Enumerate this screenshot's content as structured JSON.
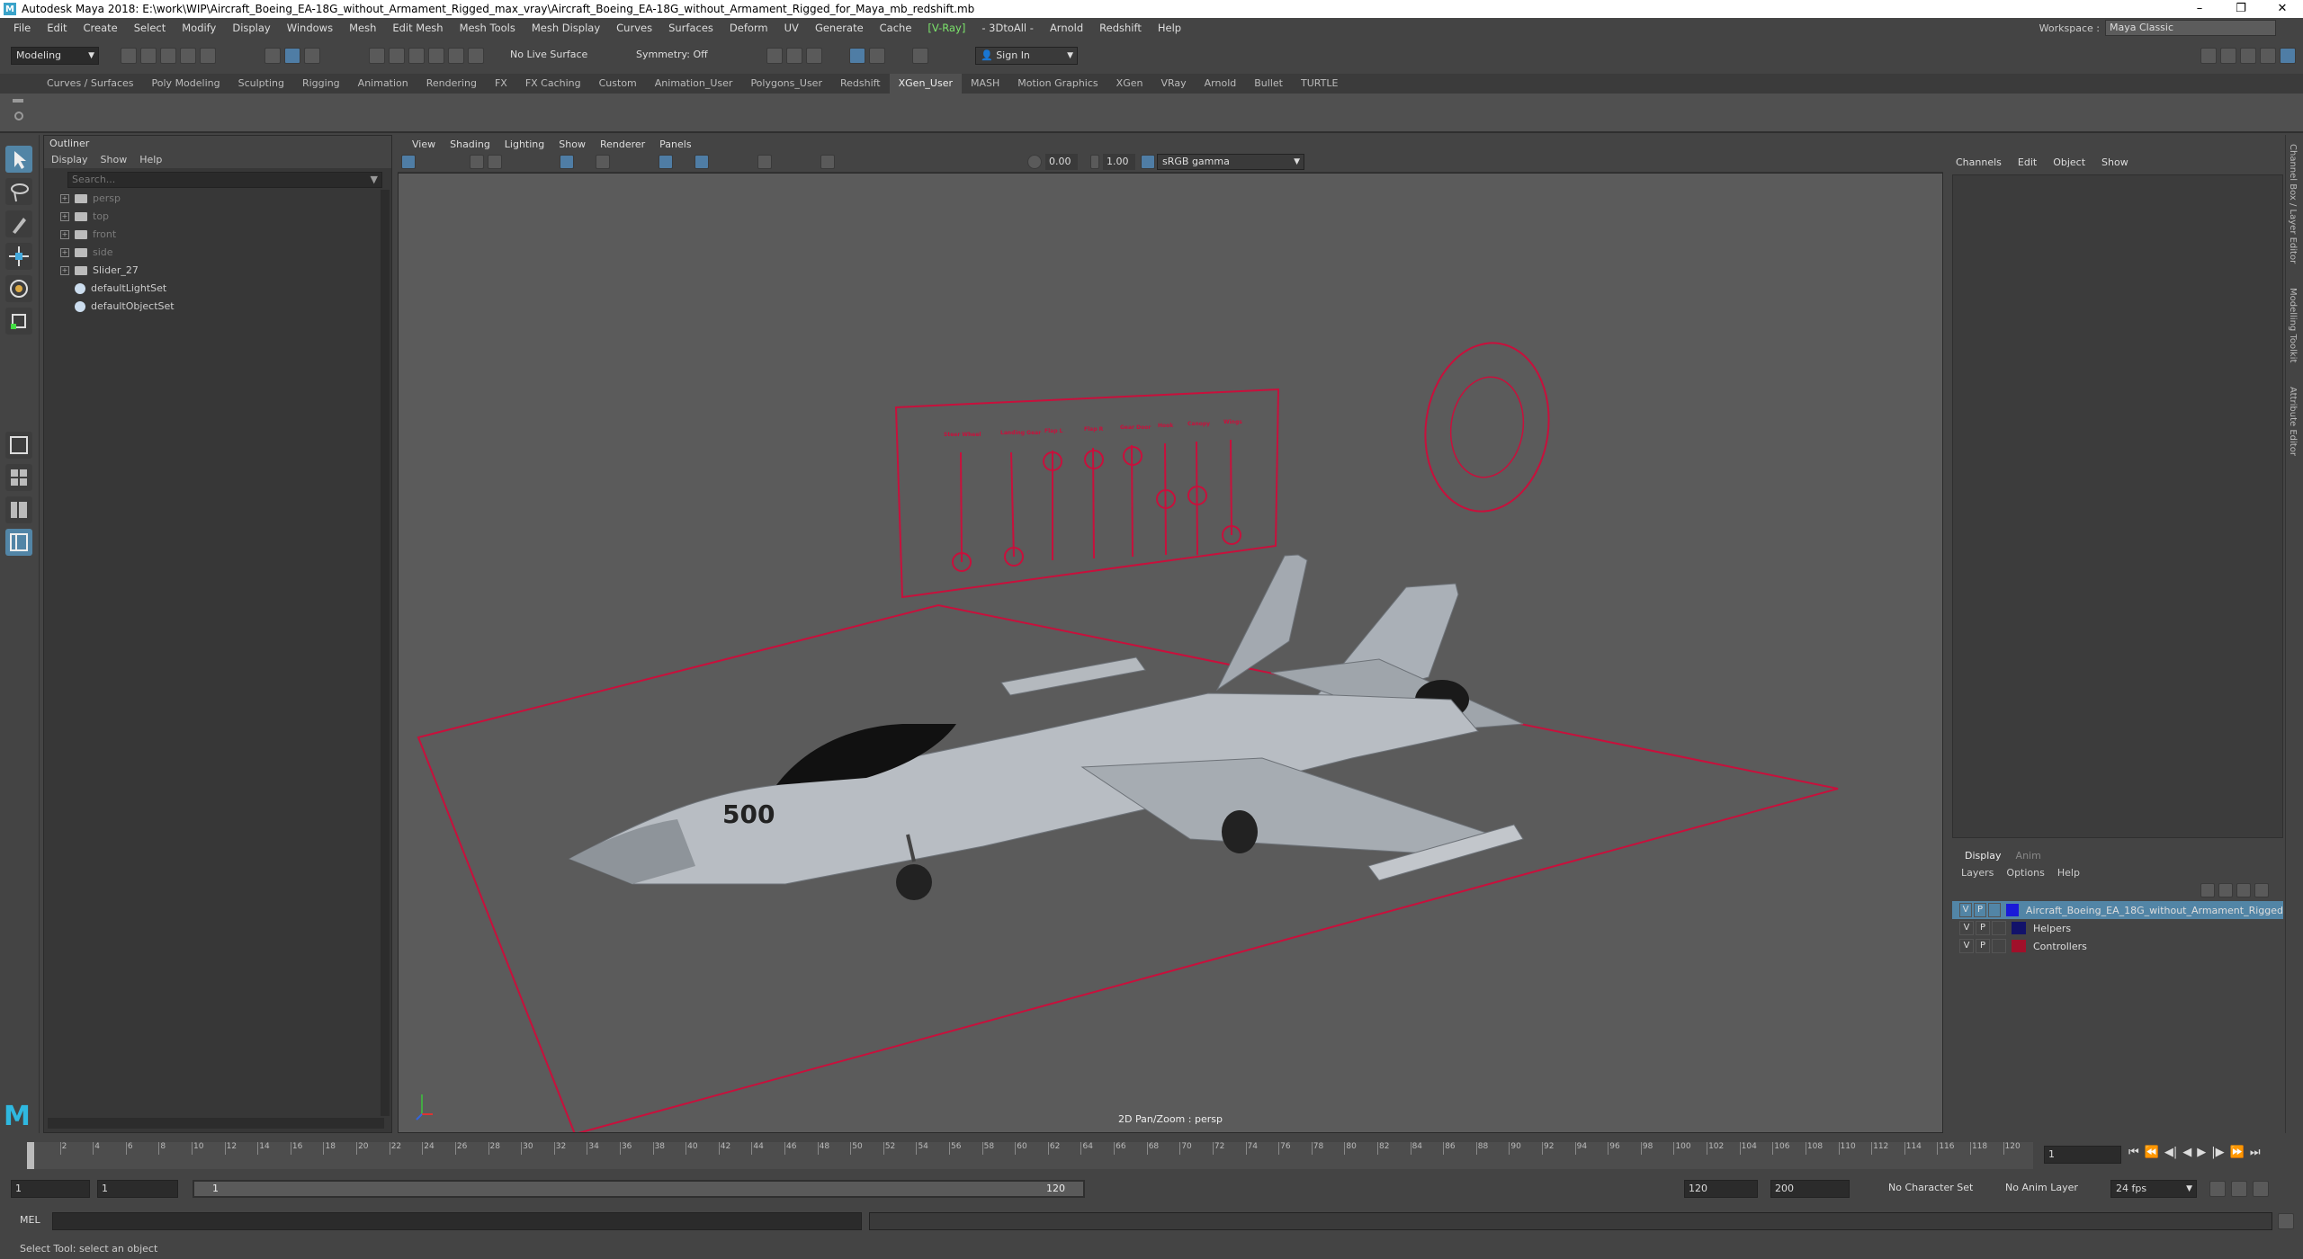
{
  "window": {
    "title": "Autodesk Maya 2018: E:\\work\\WIP\\Aircraft_Boeing_EA-18G_without_Armament_Rigged_max_vray\\Aircraft_Boeing_EA-18G_without_Armament_Rigged_for_Maya_mb_redshift.mb",
    "minimize": "–",
    "restore": "❐",
    "close": "✕"
  },
  "menubar": {
    "items": [
      "File",
      "Edit",
      "Create",
      "Select",
      "Modify",
      "Display",
      "Windows",
      "Mesh",
      "Edit Mesh",
      "Mesh Tools",
      "Mesh Display",
      "Curves",
      "Surfaces",
      "Deform",
      "UV",
      "Generate",
      "Cache",
      "V-Ray",
      "3DtoAll",
      "Arnold",
      "Redshift",
      "Help"
    ],
    "vray_label": "[V-Ray]",
    "threedtoall_label": "- 3DtoAll -"
  },
  "workspace": {
    "label": "Workspace :",
    "value": "Maya Classic"
  },
  "statusline": {
    "mode": "Modeling",
    "live_surface": "No Live Surface",
    "symmetry": "Symmetry: Off",
    "sign_in": "Sign In"
  },
  "shelf": {
    "tabs": [
      "Curves / Surfaces",
      "Poly Modeling",
      "Sculpting",
      "Rigging",
      "Animation",
      "Rendering",
      "FX",
      "FX Caching",
      "Custom",
      "Animation_User",
      "Polygons_User",
      "Redshift",
      "XGen_User",
      "MASH",
      "Motion Graphics",
      "XGen",
      "VRay",
      "Arnold",
      "Bullet",
      "TURTLE"
    ],
    "active": "XGen_User"
  },
  "outliner": {
    "title": "Outliner",
    "menu": [
      "Display",
      "Show",
      "Help"
    ],
    "search_placeholder": "Search...",
    "items": [
      {
        "label": "persp",
        "kind": "camera",
        "dim": true
      },
      {
        "label": "top",
        "kind": "camera",
        "dim": true
      },
      {
        "label": "front",
        "kind": "camera",
        "dim": true
      },
      {
        "label": "side",
        "kind": "camera",
        "dim": true
      },
      {
        "label": "Slider_27",
        "kind": "transform",
        "dim": false
      },
      {
        "label": "defaultLightSet",
        "kind": "set",
        "dim": false
      },
      {
        "label": "defaultObjectSet",
        "kind": "set",
        "dim": false
      }
    ]
  },
  "viewport": {
    "menu": [
      "View",
      "Shading",
      "Lighting",
      "Show",
      "Renderer",
      "Panels"
    ],
    "exposure": "0.00",
    "gamma": "1.00",
    "color_space": "sRGB gamma",
    "camera_label": "2D Pan/Zoom : persp",
    "aircraft_number": "500",
    "accent_color": "#c8103c",
    "slider_labels": [
      "Steer Wheel",
      "Landing Gear",
      "Flap L",
      "Flap R",
      "Gear Door",
      "Hook",
      "Canopy",
      "Wings"
    ]
  },
  "channelbox": {
    "menu": [
      "Channels",
      "Edit",
      "Object",
      "Show"
    ]
  },
  "layers": {
    "tabs": [
      "Display",
      "Anim"
    ],
    "menu": [
      "Layers",
      "Options",
      "Help"
    ],
    "rows": [
      {
        "v": "V",
        "p": "P",
        "color": "#1a1ad8",
        "name": "Aircraft_Boeing_EA_18G_without_Armament_Rigged",
        "selected": true
      },
      {
        "v": "V",
        "p": "P",
        "color": "#12126a",
        "name": "Helpers",
        "selected": false
      },
      {
        "v": "V",
        "p": "P",
        "color": "#a0102a",
        "name": "Controllers",
        "selected": false
      }
    ]
  },
  "side_tabs": [
    "Channel Box / Layer Editor",
    "Modelling Toolkit",
    "Attribute Editor"
  ],
  "timeline": {
    "ticks": [
      "2",
      "4",
      "6",
      "8",
      "10",
      "12",
      "14",
      "16",
      "18",
      "20",
      "22",
      "24",
      "26",
      "28",
      "30",
      "32",
      "34",
      "36",
      "38",
      "40",
      "42",
      "44",
      "46",
      "48",
      "50",
      "52",
      "54",
      "56",
      "58",
      "60",
      "62",
      "64",
      "66",
      "68",
      "70",
      "72",
      "74",
      "76",
      "78",
      "80",
      "82",
      "84",
      "86",
      "88",
      "90",
      "92",
      "94",
      "96",
      "98",
      "100",
      "102",
      "104",
      "106",
      "108",
      "110",
      "112",
      "114",
      "116",
      "118",
      "120"
    ],
    "current_frame": "1",
    "current_field": "1"
  },
  "range": {
    "start": "1",
    "playback_start": "1",
    "slider_left": "1",
    "slider_right": "120",
    "playback_end": "120",
    "end": "200",
    "character_set": "No Character Set",
    "anim_layer": "No Anim Layer",
    "fps": "24 fps"
  },
  "command": {
    "label": "MEL"
  },
  "help": {
    "text": "Select Tool: select an object"
  }
}
